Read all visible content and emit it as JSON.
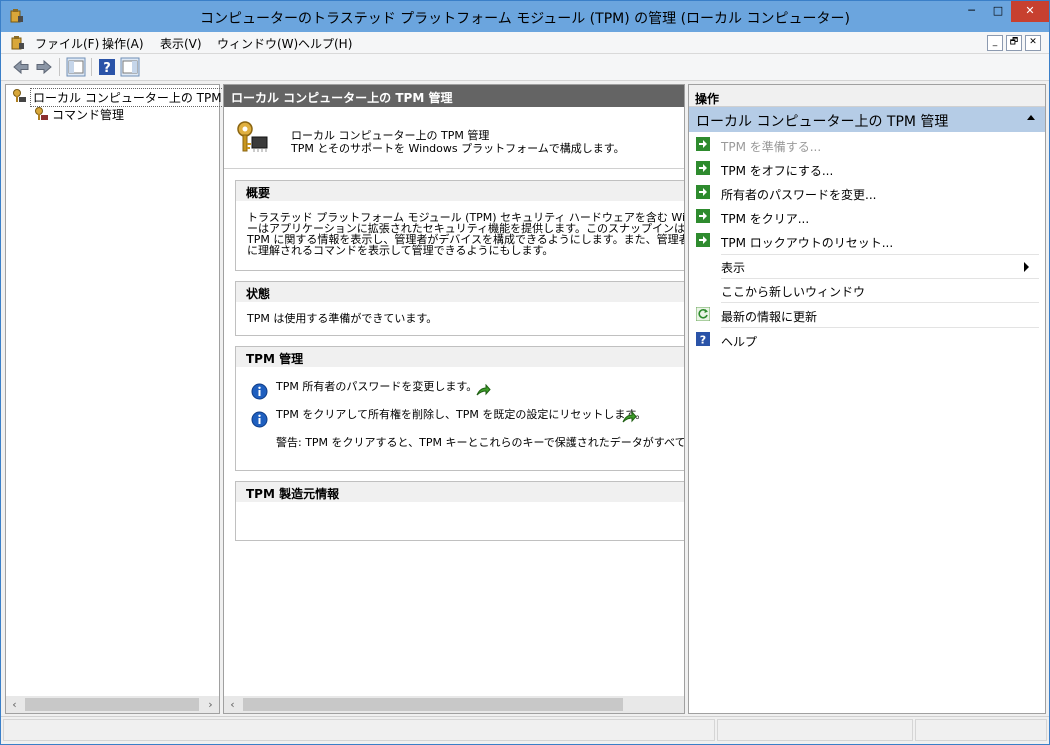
{
  "window": {
    "title": "コンピューターのトラステッド プラットフォーム モジュール (TPM) の管理 (ローカル コンピューター)",
    "min": "─",
    "max": "□",
    "close": "✕"
  },
  "menu": {
    "items": [
      "ファイル(F)",
      "操作(A)",
      "表示(V)",
      "ウィンドウ(W)",
      "ヘルプ(H)"
    ],
    "mdi": [
      "_",
      "🗗",
      "✕"
    ]
  },
  "toolbar": {
    "icons": [
      "back-icon",
      "forward-icon",
      "show-hide-tree-icon",
      "help-icon",
      "show-hide-action-pane-icon"
    ]
  },
  "tree": {
    "root": "ローカル コンピューター上の TPM 管理",
    "child": "コマンド管理"
  },
  "center": {
    "header": "ローカル コンピューター上の TPM 管理",
    "intro": [
      "ローカル コンピューター上の TPM 管理",
      "TPM とそのサポートを Windows プラットフォームで構成します。"
    ],
    "overview": {
      "title": "概要",
      "lines": [
        "トラステッド プラットフォーム モジュール (TPM) セキュリティ ハードウェアを含む Windows コンピュー",
        "ーはアプリケーションに拡張されたセキュリティ機能を提供します。このスナップインは、コンピュータ",
        "TPM に関する情報を表示し、管理者がデバイスを構成できるようにします。また、管理者がデバ",
        "に理解されるコマンドを表示して管理できるようにもします。"
      ]
    },
    "status": {
      "title": "状態",
      "text": "TPM は使用する準備ができています。"
    },
    "tpm_manage": {
      "title": "TPM 管理",
      "item1": "TPM 所有者のパスワードを変更します。",
      "item2": "TPM をクリアして所有権を削除し、TPM を既定の設定にリセットします。",
      "warning": "警告: TPM をクリアすると、TPM キーとこれらのキーで保護されたデータがすべて失われま"
    },
    "manufacturer": {
      "title": "TPM 製造元情報"
    }
  },
  "actions": {
    "title": "操作",
    "group": "ローカル コンピューター上の TPM 管理",
    "items": [
      "TPM を準備する...",
      "TPM をオフにする...",
      "所有者のパスワードを変更...",
      "TPM をクリア...",
      "TPM ロックアウトのリセット...",
      "表示",
      "ここから新しいウィンドウ",
      "最新の情報に更新",
      "ヘルプ"
    ]
  },
  "scroll": {
    "left": "‹",
    "right": "›"
  },
  "colors": {
    "titlebar": "#6ba5de",
    "close": "#c7402f",
    "action_group": "#b5cce6",
    "header_dark": "#646464",
    "action_icon_green": "#2e8b2e",
    "info_blue": "#1f5fbf"
  }
}
